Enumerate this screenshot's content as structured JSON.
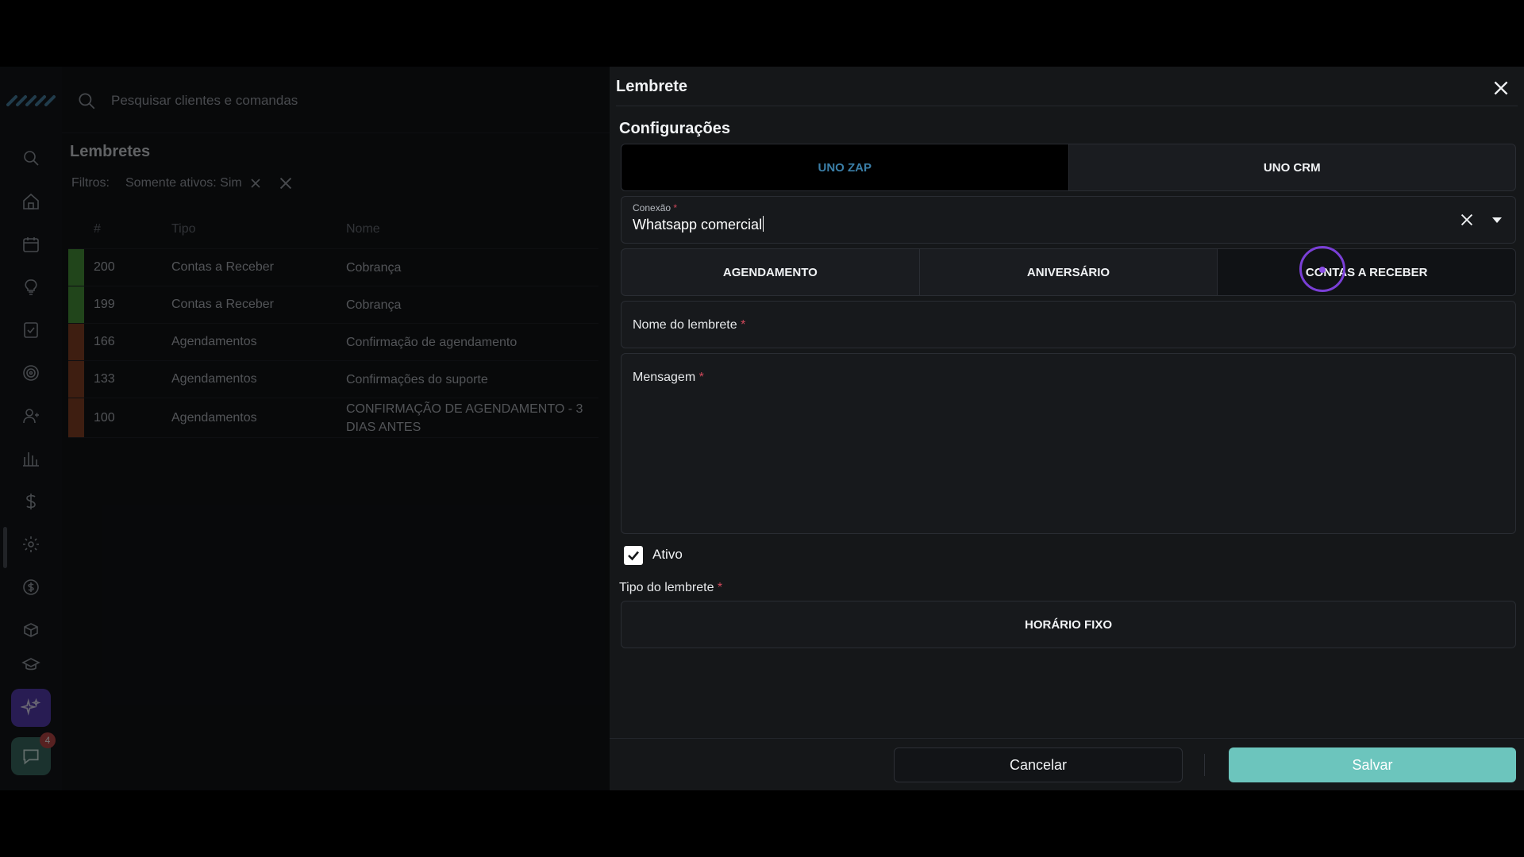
{
  "app": {
    "search": {
      "placeholder": "Pesquisar clientes e comandas"
    },
    "page_title": "Lembretes",
    "filters": {
      "label": "Filtros:",
      "chip": "Somente ativos: Sim"
    },
    "table": {
      "headers": [
        "#",
        "Tipo",
        "Nome"
      ],
      "rows": [
        {
          "id": "200",
          "tipo": "Contas a Receber",
          "nome": "Cobrança",
          "color": "#4a9a3c"
        },
        {
          "id": "199",
          "tipo": "Contas a Receber",
          "nome": "Cobrança",
          "color": "#4a9a3c"
        },
        {
          "id": "166",
          "tipo": "Agendamentos",
          "nome": "Confirmação de agendamento",
          "color": "#8a4326"
        },
        {
          "id": "133",
          "tipo": "Agendamentos",
          "nome": "Confirmações do suporte",
          "color": "#8a4326"
        },
        {
          "id": "100",
          "tipo": "Agendamentos",
          "nome": "CONFIRMAÇÃO DE AGENDAMENTO - 3 DIAS ANTES",
          "color": "#8a4326"
        }
      ]
    },
    "notification_count": "4"
  },
  "modal": {
    "title": "Lembrete",
    "section_title": "Configurações",
    "platform_tabs": [
      {
        "label": "UNO ZAP",
        "selected": true
      },
      {
        "label": "UNO CRM",
        "selected": false
      }
    ],
    "connection": {
      "label": "Conexão",
      "required_mark": "*",
      "value": "Whatsapp comercial"
    },
    "reminder_tabs": [
      {
        "label": "AGENDAMENTO",
        "selected": false
      },
      {
        "label": "ANIVERSÁRIO",
        "selected": false
      },
      {
        "label": "CONTAS A RECEBER",
        "selected": true
      }
    ],
    "name_field": {
      "label": "Nome do lembrete",
      "required_mark": "*"
    },
    "message_field": {
      "label": "Mensagem",
      "required_mark": "*"
    },
    "active": {
      "label": "Ativo",
      "checked": true
    },
    "reminder_type": {
      "label": "Tipo do lembrete",
      "required_mark": "*",
      "option": "HORÁRIO FIXO"
    },
    "cancel_label": "Cancelar",
    "save_label": "Salvar"
  },
  "colors": {
    "accent": "#6cc5bd",
    "tab_selected_text": "#3b7fa8",
    "required": "#d0485a",
    "cursor": "#7a3fd6"
  }
}
